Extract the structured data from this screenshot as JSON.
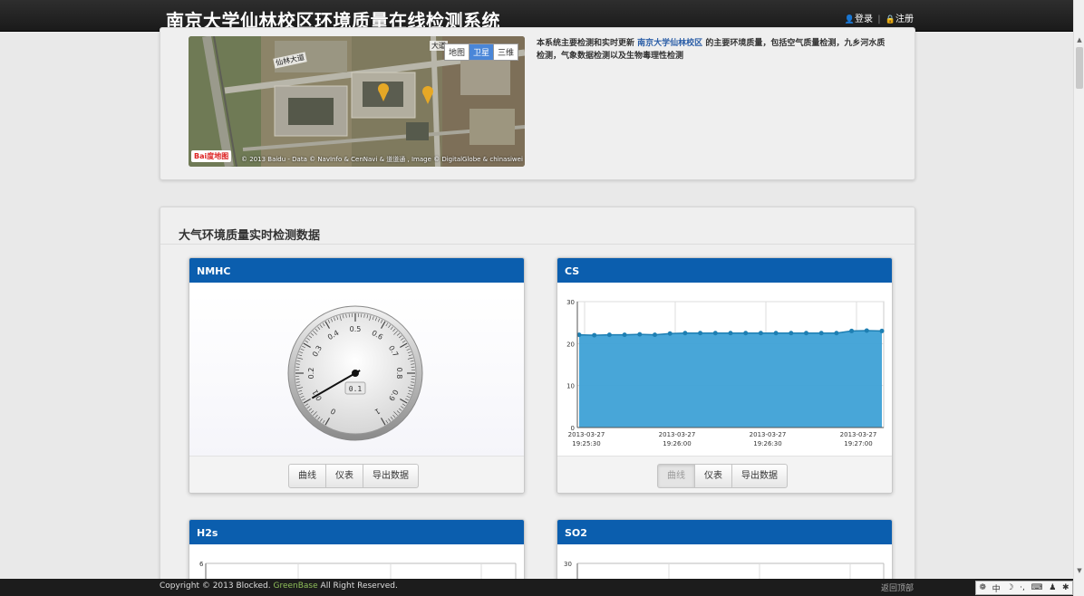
{
  "header": {
    "title": "南京大学仙林校区环境质量在线检测系统",
    "login": "登录",
    "separator": "|",
    "register": "注册"
  },
  "map": {
    "types": [
      "地图",
      "卫星",
      "三维"
    ],
    "active_type": "卫星",
    "road_label_1": "仙林大道",
    "road_label_2": "大道",
    "copyright": "© 2013 Baidu - Data © NavInfo & CenNavi & 道道通 , Image © DigitalGlobe & chinasiwei",
    "logo": "Bai度地图"
  },
  "intro": {
    "prefix": "本系统主要检测和实时更新",
    "link": "南京大学仙林校区",
    "suffix": "的主要环境质量，包括空气质量检测，九乡河水质检测，气象数据检测以及生物毒理性检测"
  },
  "section": {
    "title": "大气环境质量实时检测数据"
  },
  "widgets": {
    "nmhc": {
      "title": "NMHC",
      "gauge_value": 0.1,
      "gauge_ticks": [
        "0",
        "0.1",
        "0.2",
        "0.3",
        "0.4",
        "0.5",
        "0.6",
        "0.7",
        "0.8",
        "0.9",
        "1"
      ],
      "display": "0.1",
      "buttons": [
        "曲线",
        "仪表",
        "导出数据"
      ],
      "active_button": "仪表"
    },
    "cs": {
      "title": "CS",
      "buttons": [
        "曲线",
        "仪表",
        "导出数据"
      ],
      "active_button": "曲线"
    },
    "h2s": {
      "title": "H2s",
      "ytick_top": "6"
    },
    "so2": {
      "title": "SO2",
      "ytick_top": "30"
    }
  },
  "chart_data": {
    "type": "area",
    "color": "#3ea1d6",
    "ylim": [
      0,
      30
    ],
    "yticks": [
      "0",
      "10",
      "20",
      "30"
    ],
    "xticks": [
      {
        "date": "2013-03-27",
        "time": "19:25:30"
      },
      {
        "date": "2013-03-27",
        "time": "19:26:00"
      },
      {
        "date": "2013-03-27",
        "time": "19:26:30"
      },
      {
        "date": "2013-03-27",
        "time": "19:27:00"
      }
    ],
    "values": [
      22.1,
      22.0,
      22.1,
      22.1,
      22.2,
      22.1,
      22.4,
      22.5,
      22.5,
      22.5,
      22.5,
      22.5,
      22.5,
      22.5,
      22.5,
      22.5,
      22.5,
      22.5,
      23.0,
      23.1,
      23.0
    ]
  },
  "footer": {
    "copyright_prefix": "Copyright © 2013 Blocked.",
    "brand": "GreenBase",
    "copyright_suffix": "All Right Reserved.",
    "back_to_top": "返回顶部"
  },
  "ime": {
    "lang": "中"
  }
}
